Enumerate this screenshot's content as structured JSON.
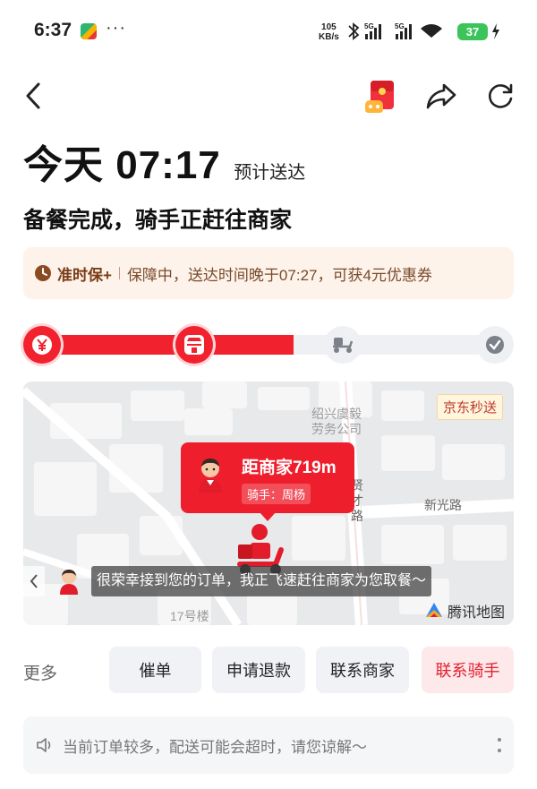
{
  "status_bar": {
    "time": "6:37",
    "dots": "···",
    "speed_value": "105",
    "speed_unit": "KB/s",
    "network_1": "5G",
    "network_2": "5G",
    "battery": "37"
  },
  "header": {
    "back_icon": "chevron-left-icon",
    "red_packet_icon": "red-packet-icon",
    "share_icon": "share-icon",
    "refresh_icon": "refresh-icon"
  },
  "eta": {
    "main": "今天 07:17",
    "sub": "预计送达"
  },
  "status_title": "备餐完成，骑手正赶往商家",
  "ontime": {
    "label": "准时保+",
    "text": "保障中，送达时间晚于07:27，可获4元优惠券"
  },
  "progress": {
    "steps": [
      {
        "icon": "yen-icon",
        "active": true
      },
      {
        "icon": "store-icon",
        "active": true
      },
      {
        "icon": "scooter-icon",
        "active": false
      },
      {
        "icon": "check-icon",
        "active": false
      }
    ],
    "fill_fraction": 0.55,
    "colors": {
      "active": "#f1212d",
      "inactive": "#eef0f3"
    }
  },
  "map": {
    "brand": "京东秒送",
    "labels": {
      "company": "绍兴虞毅\n劳务公司",
      "road_1": "贤\n才\n路",
      "road_2": "新光路",
      "building": "17号楼"
    },
    "rider_card": {
      "distance": "距商家719m",
      "rider": "骑手：周杨"
    },
    "message": "很荣幸接到您的订单，我正飞速赶往商家为您取餐～",
    "logo": "腾讯地图"
  },
  "actions": {
    "more": "更多",
    "buttons": [
      {
        "label": "催单",
        "primary": false
      },
      {
        "label": "申请退款",
        "primary": false
      },
      {
        "label": "联系商家",
        "primary": false
      },
      {
        "label": "联系骑手",
        "primary": true
      }
    ]
  },
  "notice": {
    "text": "当前订单较多，配送可能会超时，请您谅解～"
  },
  "colors": {
    "brand_red": "#f1212d",
    "ontime_bg": "#fdf3ea",
    "ontime_text": "#7a4a2a"
  }
}
